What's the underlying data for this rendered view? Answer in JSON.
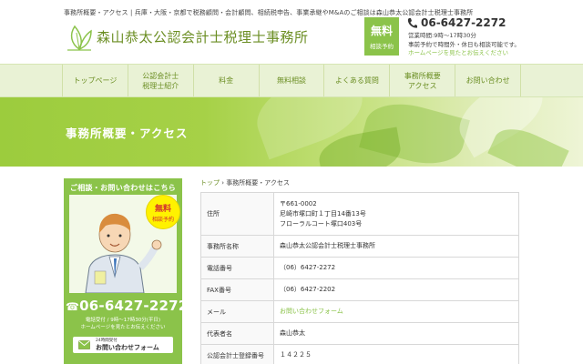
{
  "header": {
    "tagline": "事務所概要・アクセス | 兵庫・大阪・京都で税務顧問・会計顧問、相続税申告、事業承継やM&Aのご相談は森山恭太公認会計士税理士事務所",
    "site_title": "森山恭太公認会計士税理士事務所",
    "free_badge": {
      "big": "無料",
      "small": "相談予約"
    },
    "phone": "06-6427-2272",
    "hours_line1": "営業時間:9時〜17時30分",
    "hours_line2": "事前予約で時間外・休日も相談可能です。",
    "hours_line3": "ホームページを見たとお伝えください"
  },
  "nav": [
    {
      "name": "top",
      "label": "トップページ"
    },
    {
      "name": "cpa-profile",
      "label": "公認会計士\n税理士紹介"
    },
    {
      "name": "fees",
      "label": "料金"
    },
    {
      "name": "free-consultation",
      "label": "無料相談"
    },
    {
      "name": "faq",
      "label": "よくある質問"
    },
    {
      "name": "office-access",
      "label": "事務所概要\nアクセス"
    },
    {
      "name": "contact",
      "label": "お問い合わせ"
    }
  ],
  "hero": {
    "title": "事務所概要・アクセス"
  },
  "sidebar": {
    "heading": "ご相談・お問い合わせはこちら",
    "badge_big": "無料",
    "badge_small": "相談予約",
    "phone": "06-6427-2272",
    "hours_line1": "電話受付 / 9時〜17時30分(平日)",
    "hours_line2": "ホームページを見たとお伝えください",
    "form_small": "24時間受付",
    "form_label": "お問い合わせフォーム"
  },
  "breadcrumb": {
    "home": "トップ",
    "sep": "›",
    "current": "事務所概要・アクセス"
  },
  "table": {
    "address_label": "住所",
    "address_line1": "〒661-0002",
    "address_line2": "尼崎市塚口町１丁目14番13号",
    "address_line3": "フローラルコート塚口403号",
    "office_label": "事務所名称",
    "office_value": "森山恭太公認会計士税理士事務所",
    "tel_label": "電話番号",
    "tel_value": "（06）6427-2272",
    "fax_label": "FAX番号",
    "fax_value": "（06）6427-2202",
    "mail_label": "メール",
    "mail_value": "お問い合わせフォーム",
    "rep_label": "代表者名",
    "rep_value": "森山恭太",
    "reg_label": "公認会計士登録番号",
    "reg_value": "１４２２５"
  },
  "colors": {
    "accent": "#8bc34a",
    "accent_dark": "#6b8e23",
    "nav_bg": "#e9f2d5"
  }
}
